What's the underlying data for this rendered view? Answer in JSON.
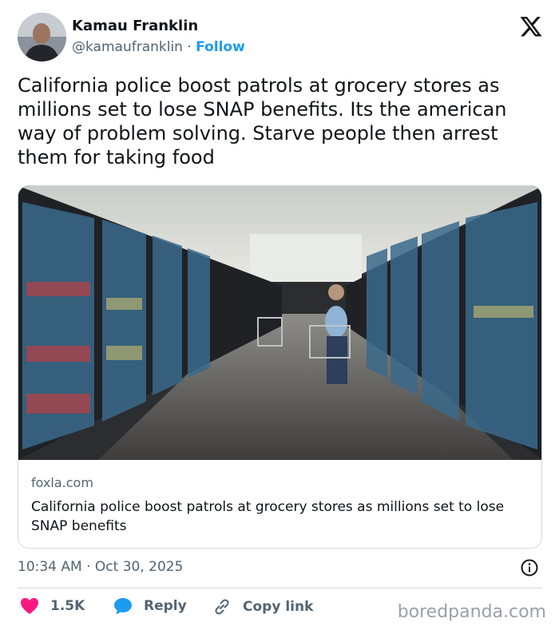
{
  "author": {
    "name": "Kamau Franklin",
    "handle": "@kamaufranklin",
    "separator": "·",
    "follow_label": "Follow"
  },
  "tweet": {
    "text": "California police boost patrols at grocery stores as millions set to lose SNAP benefits. Its the american way of problem solving. Starve people then arrest them for taking food"
  },
  "link_card": {
    "domain": "foxla.com",
    "title": "California police boost patrols at grocery stores as millions set to lose SNAP benefits"
  },
  "meta": {
    "timestamp": "10:34 AM · Oct 30, 2025"
  },
  "actions": {
    "likes_count": "1.5K",
    "reply_label": "Reply",
    "copy_link_label": "Copy link"
  },
  "watermark": "boredpanda.com",
  "colors": {
    "accent": "#1d9bf0",
    "like": "#f91880",
    "text": "#0f1419",
    "muted": "#536471"
  },
  "icons": [
    "x-logo-icon",
    "info-icon",
    "heart-icon",
    "reply-bubble-icon",
    "link-icon"
  ]
}
